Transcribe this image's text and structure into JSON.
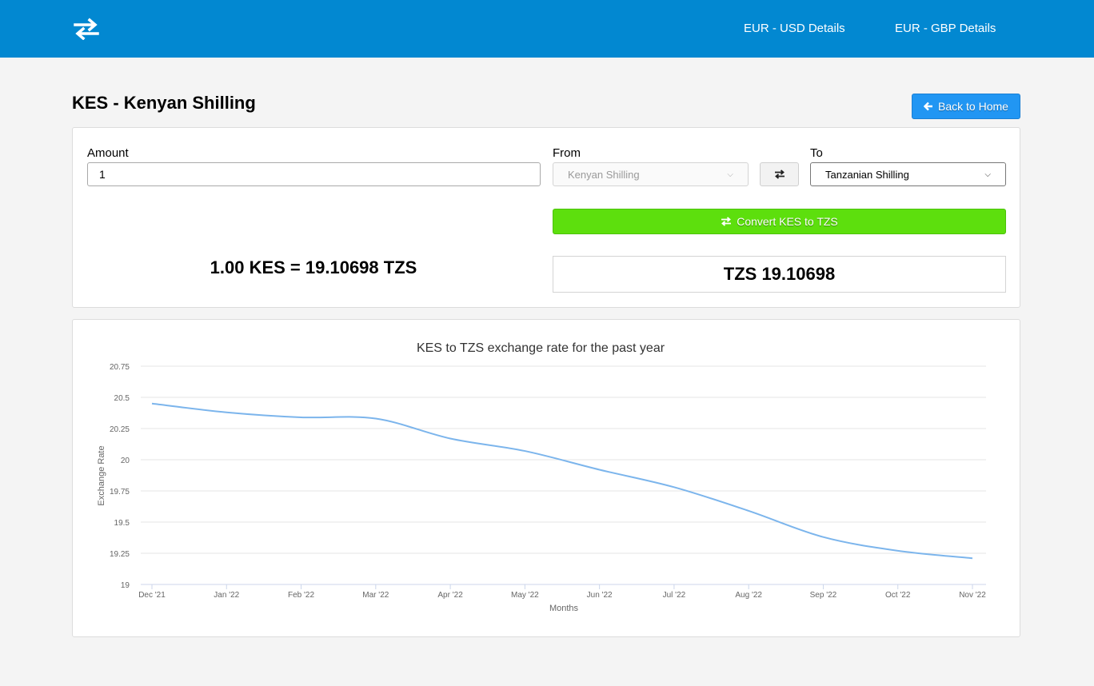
{
  "nav": {
    "logo_icon": "swap-arrows-icon",
    "links": [
      "EUR - USD Details",
      "EUR - GBP Details"
    ]
  },
  "page": {
    "title": "KES - Kenyan Shilling",
    "back_button": "Back to Home",
    "back_icon": "arrow-left-icon"
  },
  "converter": {
    "amount_label": "Amount",
    "amount_value": "1",
    "from_label": "From",
    "from_value": "Kenyan Shilling",
    "to_label": "To",
    "to_value": "Tanzanian Shilling",
    "swap_icon": "swap-arrows-icon",
    "convert_button": "Convert KES to TZS",
    "rate_text": "1.00 KES = 19.10698 TZS",
    "result": "TZS 19.10698"
  },
  "colors": {
    "navbar": "#0288d1",
    "back_button": "#2196f3",
    "convert_button": "#5ddf0d",
    "line": "#7cb5ec"
  },
  "chart_data": {
    "type": "line",
    "title": "KES to TZS exchange rate for the past year",
    "xlabel": "Months",
    "ylabel": "Exchange Rate",
    "categories": [
      "Dec '21",
      "Jan '22",
      "Feb '22",
      "Mar '22",
      "Apr '22",
      "May '22",
      "Jun '22",
      "Jul '22",
      "Aug '22",
      "Sep '22",
      "Oct '22",
      "Nov '22"
    ],
    "y_ticks": [
      "19",
      "19.25",
      "19.5",
      "19.75",
      "20",
      "20.25",
      "20.5",
      "20.75"
    ],
    "ylim": [
      19,
      20.75
    ],
    "grid": true,
    "series": [
      {
        "values": [
          20.45,
          20.38,
          20.34,
          20.33,
          20.17,
          20.07,
          19.92,
          19.78,
          19.59,
          19.38,
          19.27,
          19.21
        ]
      }
    ]
  }
}
